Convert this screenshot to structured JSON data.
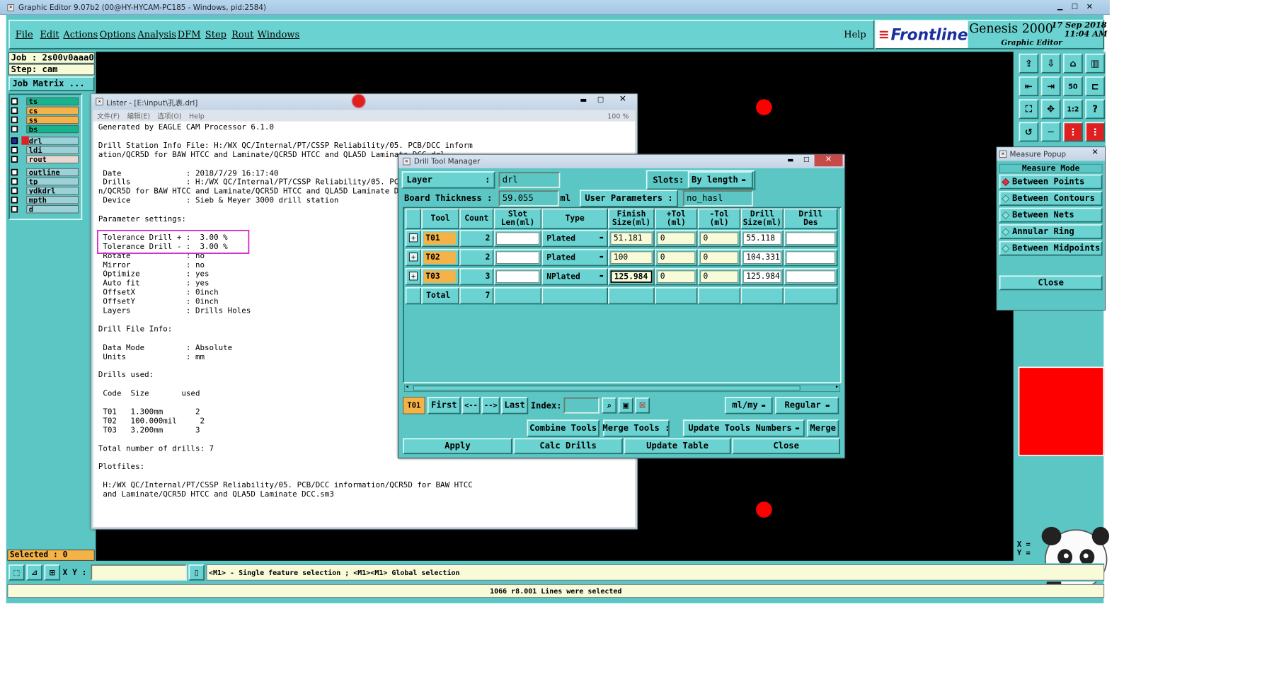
{
  "os_title": "Graphic Editor 9.07b2 (00@HY-HYCAM-PC185 - Windows, pid:2584)",
  "menus": [
    "File",
    "Edit",
    "Actions",
    "Options",
    "Analysis",
    "DFM",
    "Step",
    "Rout",
    "Windows"
  ],
  "help": "Help",
  "brand": {
    "logo": "Frontline",
    "product": "Genesis 2000",
    "subtitle": "Graphic Editor",
    "date": "17 Sep 2018",
    "time": "11:04 AM"
  },
  "job": {
    "job": "Job : 2s00v0aaa0",
    "step": "Step: cam",
    "matrix": "Job Matrix ..."
  },
  "layers": [
    {
      "name": "ts",
      "color": "#17b38a"
    },
    {
      "name": "cs",
      "color": "#f5b246"
    },
    {
      "name": "ss",
      "color": "#f5b246"
    },
    {
      "name": "bs",
      "color": "#17b38a"
    },
    {
      "name": "drl",
      "color": "#9ad2d8"
    },
    {
      "name": "ldi",
      "color": "#9ad2d8"
    },
    {
      "name": "rout",
      "color": "#e8d8d0"
    },
    {
      "name": "outline",
      "color": "#9ad2d8"
    },
    {
      "name": "tp",
      "color": "#9ad2d8"
    },
    {
      "name": "ydkdrl",
      "color": "#9ad2d8"
    },
    {
      "name": "mpth",
      "color": "#9ad2d8"
    },
    {
      "name": "d",
      "color": "#9ad2d8"
    }
  ],
  "selected": "Selected : 0",
  "lister": {
    "title": "Lister - [E:\\input\\孔表.drl]",
    "menu": [
      "文件(F)",
      "编辑(E)",
      "选项(O)",
      "Help"
    ],
    "zoom": "100 %",
    "lines": [
      "Generated by EAGLE CAM Processor 6.1.0",
      "",
      "Drill Station Info File: H:/WX QC/Internal/PT/CSSP Reliability/05. PCB/DCC inform",
      "ation/QCR5D for BAW HTCC and Laminate/QCR5D HTCC and QLA5D Laminate DCC.drl",
      "",
      " Date              : 2018/7/29 16:17:40",
      " Drills            : H:/WX QC/Internal/PT/CSSP Reliability/05. PCB/DCC informatio",
      "n/QCR5D for BAW HTCC and Laminate/QCR5D HTCC and QLA5D Laminate DCC.drd",
      " Device            : Sieb & Meyer 3000 drill station",
      "",
      "Parameter settings:",
      "",
      " Tolerance Drill + :  3.00 %",
      " Tolerance Drill - :  3.00 %",
      " Rotate            : no",
      " Mirror            : no",
      " Optimize          : yes",
      " Auto fit          : yes",
      " OffsetX           : 0inch",
      " OffsetY           : 0inch",
      " Layers            : Drills Holes",
      "",
      "Drill File Info:",
      "",
      " Data Mode         : Absolute",
      " Units             : mm",
      "",
      "Drills used:",
      "",
      " Code  Size       used",
      "",
      " T01   1.300mm       2",
      " T02   100.000mil     2",
      " T03   3.200mm       3",
      "",
      "Total number of drills: 7",
      "",
      "Plotfiles:",
      "",
      " H:/WX QC/Internal/PT/CSSP Reliability/05. PCB/DCC information/QCR5D for BAW HTCC",
      " and Laminate/QCR5D HTCC and QLA5D Laminate DCC.sm3"
    ]
  },
  "dtm": {
    "title": "Drill Tool Manager",
    "layer_label": "Layer",
    "layer_value": "drl",
    "slots_label": "Slots:",
    "slots_value": "By length",
    "thickness_label": "Board Thickness :",
    "thickness_value": "59.055",
    "thickness_unit": "ml",
    "user_params_label": "User Parameters :",
    "user_params_value": "no_hasl",
    "headers": [
      "Tool",
      "Count",
      "Slot\nLen(ml)",
      "Type",
      "Finish\nSize(ml)",
      "+Tol\n(ml)",
      "-Tol\n(ml)",
      "Drill\nSize(ml)",
      "Drill\nDes"
    ],
    "rows": [
      {
        "tool": "T01",
        "count": "2",
        "slot": "",
        "type": "Plated",
        "finish": "51.181",
        "ptol": "0",
        "mtol": "0",
        "drill": "55.118",
        "des": ""
      },
      {
        "tool": "T02",
        "count": "2",
        "slot": "",
        "type": "Plated",
        "finish": "100",
        "ptol": "0",
        "mtol": "0",
        "drill": "104.331",
        "des": ""
      },
      {
        "tool": "T03",
        "count": "3",
        "slot": "",
        "type": "NPlated",
        "finish": "125.984",
        "ptol": "0",
        "mtol": "0",
        "drill": "125.984",
        "des": ""
      }
    ],
    "total_label": "Total",
    "total_count": "7",
    "current_tool": "T01",
    "nav": {
      "first": "First",
      "prev": "<--",
      "next": "-->",
      "last": "Last",
      "index": "Index:",
      "units": "ml/my",
      "mode": "Regular"
    },
    "buttons": {
      "combine": "Combine Tools",
      "merge_tools": "Merge Tools :",
      "update_numbers": "Update Tools Numbers",
      "merge": "Merge",
      "apply": "Apply",
      "calc": "Calc Drills",
      "update_table": "Update Table",
      "close": "Close"
    }
  },
  "measure": {
    "title": "Measure Popup",
    "mode_label": "Measure Mode",
    "items": [
      "Between Points",
      "Between Contours",
      "Between Nets",
      "Annular Ring",
      "Between Midpoints"
    ],
    "close": "Close"
  },
  "status": {
    "xy_label": "X Y :",
    "hint": "<M1> - Single feature selection ; <M1><M1> Global selection",
    "message": "1066 r8.001 Lines were selected",
    "coord_x": "X =",
    "coord_y": "Y ="
  },
  "colors": {
    "bg_cyan": "#5bc6c4",
    "canvas": "#000000",
    "highlight": "#d020c8",
    "tool_cell": "#f5b246",
    "field": "#f7fbd8"
  }
}
